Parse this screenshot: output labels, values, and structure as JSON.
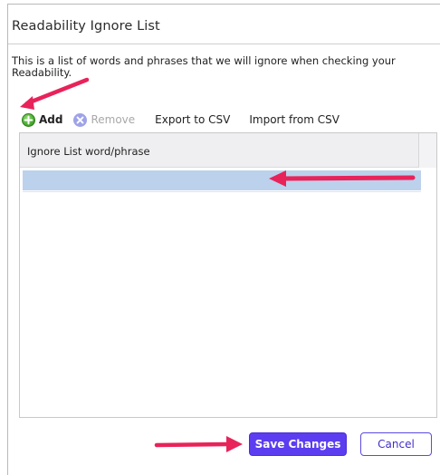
{
  "dialog": {
    "title": "Readability Ignore List",
    "description": "This is a list of words and phrases that we will ignore when checking your Readability."
  },
  "toolbar": {
    "add_label": "Add",
    "remove_label": "Remove",
    "export_label": "Export to CSV",
    "import_label": "Import from CSV",
    "add_icon": "plus-circle-icon",
    "remove_icon": "x-circle-icon"
  },
  "list": {
    "column_header": "Ignore List word/phrase",
    "rows": [
      {
        "value": ""
      }
    ]
  },
  "footer": {
    "save_label": "Save Changes",
    "cancel_label": "Cancel"
  },
  "colors": {
    "accent": "#5c3df0",
    "row_highlight": "#bcd1ec",
    "annotation_arrow": "#e8235a"
  }
}
